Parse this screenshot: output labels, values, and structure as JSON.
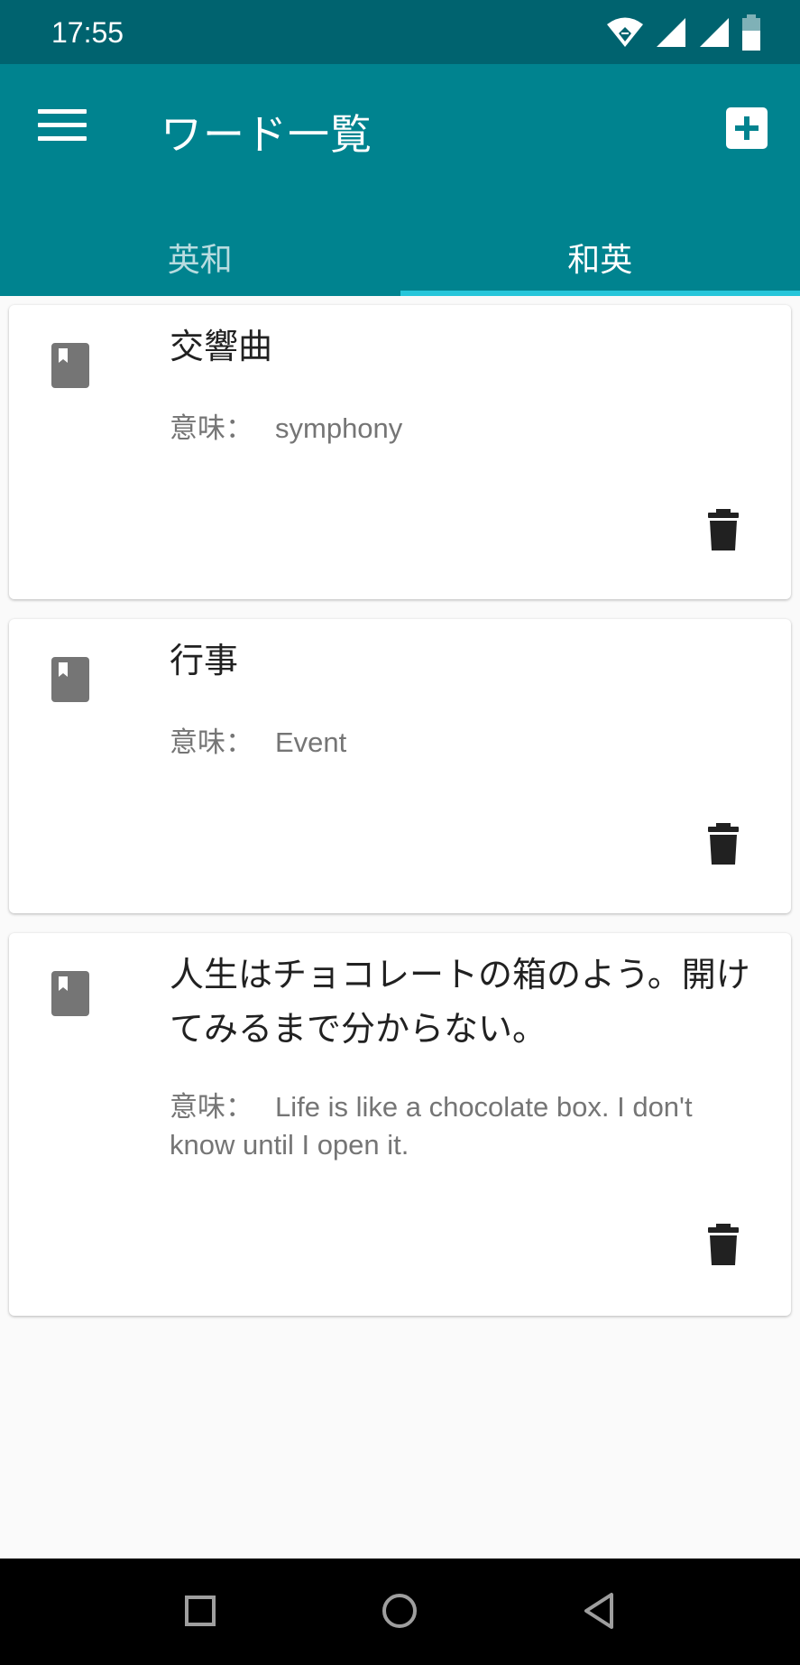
{
  "status_bar": {
    "time": "17:55",
    "icons": [
      "wifi-icon",
      "signal-icon",
      "signal-icon",
      "battery-icon"
    ]
  },
  "app_bar": {
    "title": "ワード一覧",
    "menu_icon": "menu-icon",
    "add_icon": "add-box-icon",
    "color": "#00838f",
    "status_color": "#00636f"
  },
  "tabs": [
    {
      "label": "英和",
      "active": false
    },
    {
      "label": "和英",
      "active": true
    }
  ],
  "meaning_label": "意味：",
  "words": [
    {
      "word": "交響曲",
      "meaning": "symphony"
    },
    {
      "word": "行事",
      "meaning": "Event"
    },
    {
      "word": "人生はチョコレートの箱のよう。開けてみるまで分からない。",
      "meaning": "Life is like a chocolate box. I don't know until I open it."
    }
  ],
  "nav_bar": {
    "buttons": [
      "recents-icon",
      "home-icon",
      "back-icon"
    ]
  },
  "colors": {
    "accent": "#26c6da",
    "icon_grey": "#757575",
    "delete_icon": "#212121"
  }
}
